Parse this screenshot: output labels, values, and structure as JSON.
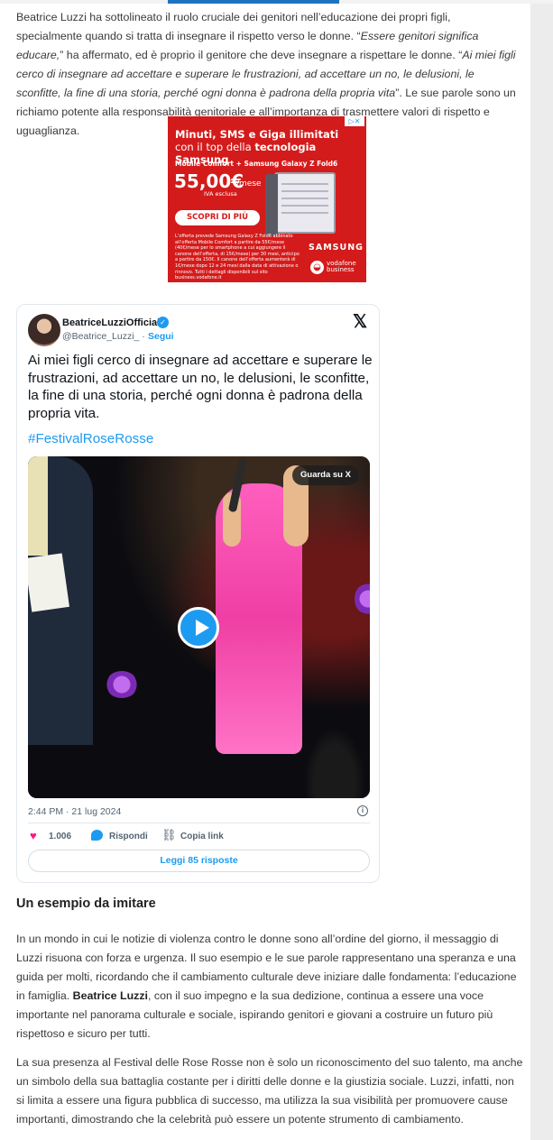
{
  "article": {
    "p1_a": "Beatrice Luzzi ha sottolineato il ruolo cruciale dei genitori nell’educazione dei propri figli, specialmente quando si tratta di insegnare il rispetto verso le donne. “",
    "p1_quote1": "Essere genitori significa educare,",
    "p1_b": "” ha affermato, ed è proprio il genitore che deve insegnare a rispettare le donne. “",
    "p1_quote2": "Ai miei figli cerco di insegnare ad accettare e superare le frustrazioni, ad accettare un no, le delusioni, le sconfitte, la fine di una storia, perché ogni donna è padrona della propria vita",
    "p1_c": "”. Le sue parole sono un richiamo potente alla responsabilità genitoriale e all’importanza di trasmettere valori di rispetto e uguaglianza.",
    "heading": "Un esempio da imitare",
    "p2_a": "In un mondo in cui le notizie di violenza contro le donne sono all’ordine del giorno, il messaggio di Luzzi risuona con forza e urgenza. Il suo esempio e le sue parole rappresentano una speranza e una guida per molti, ricordando che il cambiamento culturale deve iniziare dalle fondamenta: l’educazione in famiglia. ",
    "p2_bold": "Beatrice Luzzi",
    "p2_b": ", con il suo impegno e la sua dedizione, continua a essere una voce importante nel panorama culturale e sociale, ispirando genitori e giovani a costruire un futuro più rispettoso e sicuro per tutti.",
    "p3": "La sua presenza al Festival delle Rose Rosse non è solo un riconoscimento del suo talento, ma anche un simbolo della sua battaglia costante per i diritti delle donne e la giustizia sociale. Luzzi, infatti, non si limita a essere una figura pubblica di successo, ma utilizza la sua visibilità per promuovere cause importanti, dimostrando che la celebrità può essere un potente strumento di cambiamento."
  },
  "ad": {
    "adchoice": "▷✕",
    "headline1": "Minuti, SMS e Giga illimitati",
    "headline2_a": "con il top della ",
    "headline2_b": "tecnologia Samsung",
    "sub": "Mobile Comfort + Samsung Galaxy Z Fold6",
    "price": "55,00€",
    "per": "/mese",
    "iva": "IVA esclusa",
    "cta": "SCOPRI DI PIÙ",
    "small": "L’offerta prevede Samsung Galaxy Z Fold6 abbinato all’offerta Mobile Comfort a partire da 55€/mese (40€/mese per lo smartphone a cui aggiungere il canone dell’offerta, di 15€/mese) per 30 mesi, anticipo a partire da 150€. Il canone dell’offerta aumenterà di 1€/mese dopo 12 e 24 mesi dalla data di attivazione o rinnovo. Tutti i dettagli disponibili sul sito business.vodafone.it",
    "brand": "SAMSUNG",
    "vodafone1": "vodafone",
    "vodafone2": "business"
  },
  "tweet": {
    "name": "BeatriceLuzziOfficial",
    "handle": "@Beatrice_Luzzi_ ·",
    "follow": "Segui",
    "text": "Ai miei figli cerco di insegnare ad accettare e superare le frustrazioni, ad accettare un no, le delusioni, le sconfitte, la fine di una storia, perché ogni donna è padrona della propria vita.",
    "hashtag": "#FestivalRoseRosse",
    "watch": "Guarda su X",
    "time": "2:44 PM · 21 lug 2024",
    "likes": "1.006",
    "reply": "Rispondi",
    "copy": "Copia link",
    "more": "Leggi 85 risposte"
  },
  "icons": {
    "x": "𝕏",
    "info": "i",
    "heart": "♥",
    "link": "🔗",
    "verified": "✓"
  }
}
